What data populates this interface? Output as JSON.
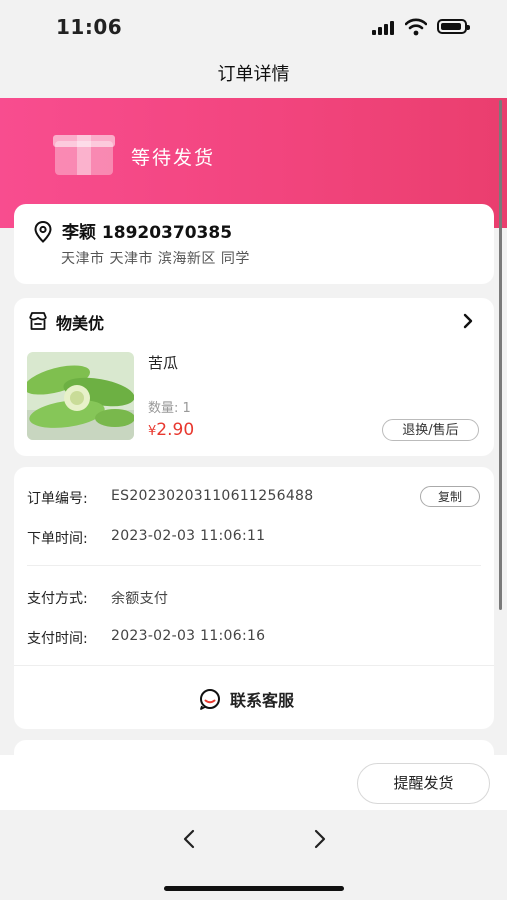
{
  "status_bar": {
    "time": "11:06"
  },
  "nav": {
    "title": "订单详情"
  },
  "hero": {
    "status": "等待发货"
  },
  "address": {
    "name_phone": "李颖 18920370385",
    "detail": "天津市 天津市 滨海新区 同学"
  },
  "shop": {
    "name": "物美优",
    "product": {
      "name": "苦瓜",
      "qty_label": "数量: 1",
      "currency": "¥",
      "price": "2.90",
      "after_sale_label": "退换/售后"
    }
  },
  "order": {
    "number_label": "订单编号:",
    "number_value": "ES2023020311061125648​8",
    "copy_label": "复制",
    "created_label": "下单时间:",
    "created_value": "2023-02-03 11:06:11",
    "pay_method_label": "支付方式:",
    "pay_method_value": "余额支付",
    "paid_label": "支付时间:",
    "paid_value": "2023-02-03 11:06:16",
    "service_label": "联系客服"
  },
  "actions": {
    "remind_label": "提醒发货"
  },
  "colors": {
    "accent": "#f1447c",
    "price": "#e8382f"
  }
}
